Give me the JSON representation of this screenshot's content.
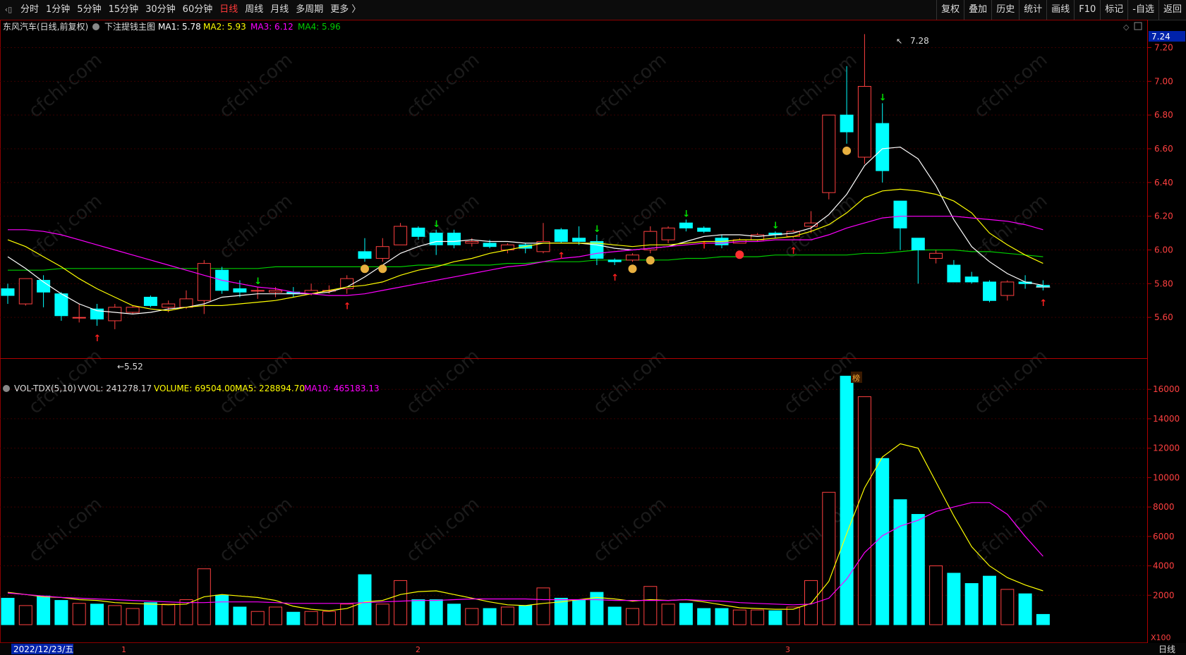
{
  "toolbar": {
    "periods": [
      "分时",
      "1分钟",
      "5分钟",
      "15分钟",
      "30分钟",
      "60分钟",
      "日线",
      "周线",
      "月线",
      "多周期",
      "更多 〉"
    ],
    "active_period": "日线",
    "right_buttons": [
      "复权",
      "叠加",
      "历史",
      "统计",
      "画线",
      "F10",
      "标记",
      "-自选",
      "返回"
    ]
  },
  "main_legend": {
    "stock": "东风汽车(日线,前复权)",
    "indicator": "下注提钱主图",
    "ma1": "MA1: 5.78",
    "ma2": "MA2: 5.93",
    "ma3": "MA3: 6.12",
    "ma4": "MA4: 5.96"
  },
  "vol_legend": {
    "name": "VOL-TDX(5,10)",
    "vvol": "VVOL: 241278.17",
    "volume": "VOLUME: 69504.00",
    "ma5": "MA5: 228894.70",
    "ma10": "MA10: 465183.13"
  },
  "price_axis": {
    "current": "7.24",
    "ticks": [
      "7.20",
      "7.00",
      "6.80",
      "6.60",
      "6.40",
      "6.20",
      "6.00",
      "5.80",
      "5.60"
    ]
  },
  "vol_axis": {
    "ticks": [
      "16000",
      "14000",
      "12000",
      "10000",
      "8000",
      "6000",
      "4000",
      "2000"
    ],
    "unit": "X100"
  },
  "annotations": {
    "high": "7.28",
    "low": "←5.52",
    "bang": "榜"
  },
  "footer": {
    "date": "2022/12/23/五",
    "month_markers": [
      "1",
      "2",
      "3"
    ],
    "period_label": "日线"
  },
  "watermark": "cfchi.com",
  "colors": {
    "up": "#ff4040",
    "down": "#00ffff",
    "ma1": "#ffffff",
    "ma2": "#ffff00",
    "ma3": "#ff00ff",
    "ma4": "#00cc00",
    "bg": "#000000"
  },
  "chart_data": {
    "type": "candlestick",
    "price_range": [
      5.4,
      7.34
    ],
    "volume_range": [
      0,
      17400
    ],
    "candles": [
      {
        "o": 5.77,
        "c": 5.73,
        "h": 5.8,
        "l": 5.68,
        "v": 1800
      },
      {
        "o": 5.68,
        "c": 5.83,
        "h": 5.83,
        "l": 5.67,
        "v": 1300
      },
      {
        "o": 5.82,
        "c": 5.75,
        "h": 5.85,
        "l": 5.66,
        "v": 1950
      },
      {
        "o": 5.74,
        "c": 5.61,
        "h": 5.75,
        "l": 5.58,
        "v": 1650
      },
      {
        "o": 5.6,
        "c": 5.6,
        "h": 5.68,
        "l": 5.57,
        "v": 1450
      },
      {
        "o": 5.65,
        "c": 5.59,
        "h": 5.68,
        "l": 5.55,
        "v": 1400
      },
      {
        "o": 5.58,
        "c": 5.66,
        "h": 5.68,
        "l": 5.53,
        "v": 1300
      },
      {
        "o": 5.63,
        "c": 5.66,
        "h": 5.67,
        "l": 5.62,
        "v": 1100
      },
      {
        "o": 5.72,
        "c": 5.67,
        "h": 5.73,
        "l": 5.66,
        "v": 1500
      },
      {
        "o": 5.66,
        "c": 5.68,
        "h": 5.7,
        "l": 5.63,
        "v": 1400
      },
      {
        "o": 5.66,
        "c": 5.71,
        "h": 5.76,
        "l": 5.65,
        "v": 1700
      },
      {
        "o": 5.7,
        "c": 5.92,
        "h": 5.94,
        "l": 5.62,
        "v": 3800
      },
      {
        "o": 5.88,
        "c": 5.76,
        "h": 5.9,
        "l": 5.74,
        "v": 2000
      },
      {
        "o": 5.77,
        "c": 5.75,
        "h": 5.82,
        "l": 5.72,
        "v": 1200
      },
      {
        "o": 5.76,
        "c": 5.76,
        "h": 5.78,
        "l": 5.71,
        "v": 900
      },
      {
        "o": 5.75,
        "c": 5.76,
        "h": 5.78,
        "l": 5.72,
        "v": 1200
      },
      {
        "o": 5.75,
        "c": 5.74,
        "h": 5.78,
        "l": 5.72,
        "v": 850
      },
      {
        "o": 5.74,
        "c": 5.76,
        "h": 5.8,
        "l": 5.73,
        "v": 900
      },
      {
        "o": 5.76,
        "c": 5.76,
        "h": 5.79,
        "l": 5.74,
        "v": 900
      },
      {
        "o": 5.77,
        "c": 5.83,
        "h": 5.85,
        "l": 5.74,
        "v": 1400
      },
      {
        "o": 5.99,
        "c": 5.95,
        "h": 6.07,
        "l": 5.93,
        "v": 3400
      },
      {
        "o": 5.95,
        "c": 6.02,
        "h": 6.07,
        "l": 5.93,
        "v": 1400
      },
      {
        "o": 6.03,
        "c": 6.14,
        "h": 6.16,
        "l": 6.03,
        "v": 3000
      },
      {
        "o": 6.13,
        "c": 6.08,
        "h": 6.14,
        "l": 6.06,
        "v": 1700
      },
      {
        "o": 6.1,
        "c": 6.03,
        "h": 6.12,
        "l": 5.97,
        "v": 1700
      },
      {
        "o": 6.1,
        "c": 6.03,
        "h": 6.12,
        "l": 6.01,
        "v": 1400
      },
      {
        "o": 6.04,
        "c": 6.05,
        "h": 6.07,
        "l": 6.02,
        "v": 1100
      },
      {
        "o": 6.04,
        "c": 6.02,
        "h": 6.06,
        "l": 6.01,
        "v": 1100
      },
      {
        "o": 6.0,
        "c": 6.03,
        "h": 6.04,
        "l": 5.98,
        "v": 1200
      },
      {
        "o": 6.03,
        "c": 6.01,
        "h": 6.04,
        "l": 5.98,
        "v": 1300
      },
      {
        "o": 5.99,
        "c": 6.05,
        "h": 6.16,
        "l": 5.98,
        "v": 2500
      },
      {
        "o": 6.12,
        "c": 6.05,
        "h": 6.13,
        "l": 6.04,
        "v": 1800
      },
      {
        "o": 6.07,
        "c": 6.05,
        "h": 6.14,
        "l": 6.03,
        "v": 1700
      },
      {
        "o": 6.05,
        "c": 5.95,
        "h": 6.09,
        "l": 5.91,
        "v": 2200
      },
      {
        "o": 5.94,
        "c": 5.93,
        "h": 5.95,
        "l": 5.91,
        "v": 1200
      },
      {
        "o": 5.94,
        "c": 5.97,
        "h": 5.98,
        "l": 5.93,
        "v": 1100
      },
      {
        "o": 6.0,
        "c": 6.11,
        "h": 6.14,
        "l": 5.98,
        "v": 2600
      },
      {
        "o": 6.06,
        "c": 6.13,
        "h": 6.14,
        "l": 6.04,
        "v": 1400
      },
      {
        "o": 6.16,
        "c": 6.13,
        "h": 6.18,
        "l": 6.11,
        "v": 1450
      },
      {
        "o": 6.13,
        "c": 6.11,
        "h": 6.14,
        "l": 6.1,
        "v": 1100
      },
      {
        "o": 6.07,
        "c": 6.03,
        "h": 6.09,
        "l": 6.01,
        "v": 1100
      },
      {
        "o": 6.04,
        "c": 6.06,
        "h": 6.07,
        "l": 6.04,
        "v": 1000
      },
      {
        "o": 6.06,
        "c": 6.09,
        "h": 6.1,
        "l": 6.05,
        "v": 1000
      },
      {
        "o": 6.1,
        "c": 6.09,
        "h": 6.11,
        "l": 6.07,
        "v": 950
      },
      {
        "o": 6.08,
        "c": 6.11,
        "h": 6.12,
        "l": 6.07,
        "v": 1200
      },
      {
        "o": 6.14,
        "c": 6.16,
        "h": 6.23,
        "l": 6.1,
        "v": 3000
      },
      {
        "o": 6.34,
        "c": 6.8,
        "h": 6.8,
        "l": 6.3,
        "v": 9000
      },
      {
        "o": 6.8,
        "c": 6.7,
        "h": 7.09,
        "l": 6.63,
        "v": 16900
      },
      {
        "o": 6.55,
        "c": 6.97,
        "h": 7.28,
        "l": 6.51,
        "v": 15500
      },
      {
        "o": 6.75,
        "c": 6.47,
        "h": 6.87,
        "l": 6.4,
        "v": 11300
      },
      {
        "o": 6.29,
        "c": 6.13,
        "h": 6.29,
        "l": 6.0,
        "v": 8500
      },
      {
        "o": 6.07,
        "c": 6.0,
        "h": 6.07,
        "l": 5.8,
        "v": 7500
      },
      {
        "o": 5.95,
        "c": 5.98,
        "h": 6.0,
        "l": 5.92,
        "v": 4000
      },
      {
        "o": 5.91,
        "c": 5.81,
        "h": 5.94,
        "l": 5.81,
        "v": 3500
      },
      {
        "o": 5.84,
        "c": 5.81,
        "h": 5.87,
        "l": 5.8,
        "v": 2800
      },
      {
        "o": 5.81,
        "c": 5.7,
        "h": 5.82,
        "l": 5.69,
        "v": 3300
      },
      {
        "o": 5.73,
        "c": 5.81,
        "h": 5.82,
        "l": 5.7,
        "v": 2400
      },
      {
        "o": 5.81,
        "c": 5.8,
        "h": 5.85,
        "l": 5.77,
        "v": 2100
      },
      {
        "o": 5.79,
        "c": 5.78,
        "h": 5.82,
        "l": 5.76,
        "v": 700
      }
    ],
    "ma4_line": [
      5.88,
      5.88,
      5.88,
      5.89,
      5.89,
      5.89,
      5.89,
      5.89,
      5.89,
      5.89,
      5.89,
      5.89,
      5.89,
      5.89,
      5.89,
      5.9,
      5.9,
      5.9,
      5.9,
      5.9,
      5.9,
      5.9,
      5.9,
      5.91,
      5.91,
      5.91,
      5.91,
      5.91,
      5.92,
      5.92,
      5.93,
      5.93,
      5.93,
      5.94,
      5.94,
      5.94,
      5.94,
      5.94,
      5.95,
      5.95,
      5.96,
      5.96,
      5.96,
      5.97,
      5.97,
      5.97,
      5.97,
      5.97,
      5.98,
      5.98,
      5.99,
      6.0,
      6.0,
      6.0,
      5.99,
      5.99,
      5.98,
      5.97,
      5.96
    ],
    "series": [
      {
        "name": "MA1",
        "values": [
          5.96,
          5.89,
          5.81,
          5.74,
          5.68,
          5.64,
          5.63,
          5.62,
          5.63,
          5.65,
          5.66,
          5.68,
          5.72,
          5.73,
          5.74,
          5.74,
          5.74,
          5.74,
          5.75,
          5.78,
          5.84,
          5.91,
          5.98,
          6.02,
          6.05,
          6.05,
          6.06,
          6.05,
          6.05,
          6.04,
          6.04,
          6.04,
          6.04,
          6.03,
          6.01,
          6.0,
          6.01,
          6.02,
          6.05,
          6.08,
          6.09,
          6.09,
          6.08,
          6.09,
          6.1,
          6.13,
          6.21,
          6.33,
          6.5,
          6.6,
          6.61,
          6.54,
          6.38,
          6.18,
          6.02,
          5.93,
          5.86,
          5.81,
          5.79
        ]
      },
      {
        "name": "MA2",
        "values": [
          6.06,
          6.02,
          5.96,
          5.9,
          5.83,
          5.77,
          5.72,
          5.67,
          5.65,
          5.64,
          5.66,
          5.67,
          5.67,
          5.68,
          5.69,
          5.7,
          5.72,
          5.74,
          5.76,
          5.78,
          5.79,
          5.81,
          5.85,
          5.88,
          5.9,
          5.93,
          5.95,
          5.98,
          6.0,
          6.02,
          6.04,
          6.04,
          6.04,
          6.04,
          6.03,
          6.02,
          6.03,
          6.03,
          6.04,
          6.05,
          6.05,
          6.06,
          6.06,
          6.07,
          6.08,
          6.11,
          6.15,
          6.22,
          6.31,
          6.35,
          6.36,
          6.35,
          6.33,
          6.29,
          6.22,
          6.1,
          6.03,
          5.97,
          5.92
        ]
      },
      {
        "name": "MA3",
        "values": [
          6.12,
          6.12,
          6.11,
          6.09,
          6.06,
          6.03,
          6.0,
          5.97,
          5.94,
          5.91,
          5.88,
          5.85,
          5.82,
          5.8,
          5.78,
          5.77,
          5.75,
          5.74,
          5.73,
          5.73,
          5.74,
          5.76,
          5.78,
          5.8,
          5.82,
          5.84,
          5.86,
          5.88,
          5.9,
          5.91,
          5.93,
          5.95,
          5.96,
          5.98,
          5.99,
          6.0,
          6.01,
          6.02,
          6.03,
          6.04,
          6.04,
          6.05,
          6.05,
          6.06,
          6.06,
          6.06,
          6.09,
          6.13,
          6.16,
          6.19,
          6.2,
          6.2,
          6.2,
          6.2,
          6.19,
          6.18,
          6.17,
          6.15,
          6.12
        ]
      }
    ],
    "volume_ma": [
      {
        "name": "MA5",
        "values": [
          2200,
          2050,
          1900,
          1850,
          1700,
          1650,
          1500,
          1450,
          1400,
          1350,
          1400,
          1900,
          2050,
          1950,
          1850,
          1650,
          1250,
          1050,
          950,
          1100,
          1550,
          1650,
          2050,
          2250,
          2300,
          2050,
          1800,
          1550,
          1350,
          1300,
          1450,
          1550,
          1700,
          1850,
          1750,
          1600,
          1700,
          1650,
          1700,
          1550,
          1350,
          1150,
          1100,
          1050,
          1050,
          1450,
          2950,
          6200,
          9300,
          11400,
          12300,
          12000,
          9700,
          7400,
          5300,
          4000,
          3200,
          2700,
          2300
        ]
      },
      {
        "name": "MA10",
        "values": [
          2150,
          2050,
          1950,
          1850,
          1800,
          1750,
          1700,
          1650,
          1600,
          1550,
          1500,
          1500,
          1550,
          1550,
          1550,
          1500,
          1450,
          1450,
          1450,
          1450,
          1500,
          1550,
          1600,
          1650,
          1650,
          1700,
          1750,
          1750,
          1750,
          1750,
          1700,
          1700,
          1700,
          1700,
          1650,
          1650,
          1650,
          1650,
          1700,
          1650,
          1600,
          1500,
          1450,
          1400,
          1350,
          1400,
          1800,
          3100,
          4900,
          6050,
          6700,
          7100,
          7700,
          8000,
          8300,
          8300,
          7500,
          6000,
          4650
        ]
      }
    ]
  }
}
